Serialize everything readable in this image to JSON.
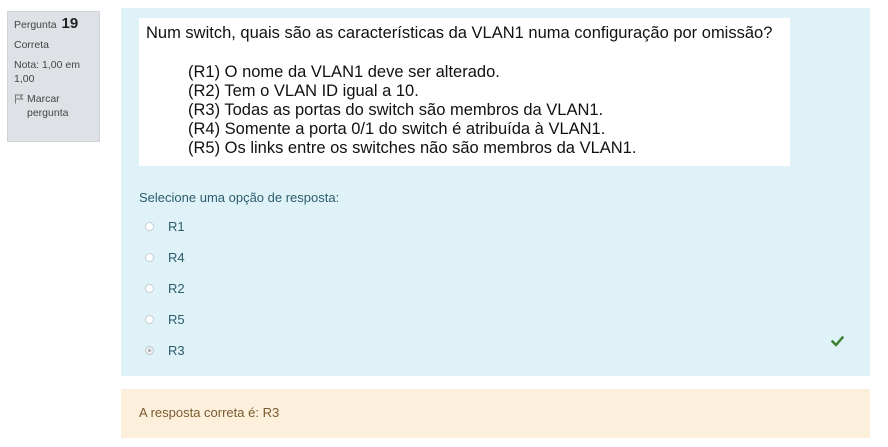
{
  "question_info": {
    "label": "Pergunta",
    "number": "19",
    "state": "Correta",
    "grade": "Nota: 1,00 em 1,00",
    "flag_label": "Marcar pergunta"
  },
  "question": {
    "text": "Num switch, quais são as características da VLAN1 numa configuração por omissão?",
    "statements": [
      "(R1)  O nome da VLAN1 deve ser alterado.",
      "(R2)  Tem o VLAN ID igual a 10.",
      "(R3)  Todas as portas do switch são membros da VLAN1.",
      "(R4)  Somente a porta 0/1 do switch é atribuída à VLAN1.",
      "(R5)  Os links entre os switches não são membros da VLAN1."
    ]
  },
  "prompt": "Selecione uma opção de resposta:",
  "answers": [
    {
      "label": "R1",
      "selected": false
    },
    {
      "label": "R4",
      "selected": false
    },
    {
      "label": "R2",
      "selected": false
    },
    {
      "label": "R5",
      "selected": false
    },
    {
      "label": "R3",
      "selected": true
    }
  ],
  "feedback": "A resposta correta é: R3",
  "colors": {
    "formulation_bg": "#def2f8",
    "outcome_bg": "#fcefdc",
    "info_bg": "#dee2e6",
    "correct_check": "#3a7f2f"
  },
  "icons": {
    "flag": "flag-icon",
    "correct": "check-icon"
  }
}
